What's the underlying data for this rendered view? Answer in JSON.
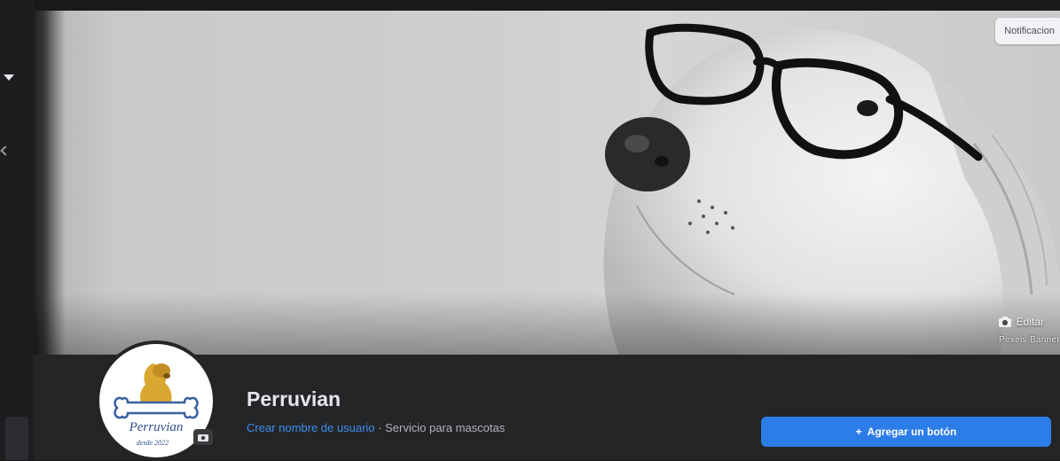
{
  "app": {
    "title": "Perruvian"
  },
  "cover": {
    "notifications_label": "Notificacion",
    "edit_label": "Editar",
    "watermark": "Pexels Banner"
  },
  "profile": {
    "name": "Perruvian",
    "username_link": "Crear nombre de usuario",
    "separator": "·",
    "category": "Servicio para mascotas",
    "logo_text": "Perruvian",
    "logo_subtext": "desde 2022"
  },
  "actions": {
    "add_button_label": "Agregar un botón",
    "add_button_icon": "+"
  },
  "colors": {
    "accent": "#2d7de8",
    "link": "#3f8df3",
    "background": "#242526"
  }
}
